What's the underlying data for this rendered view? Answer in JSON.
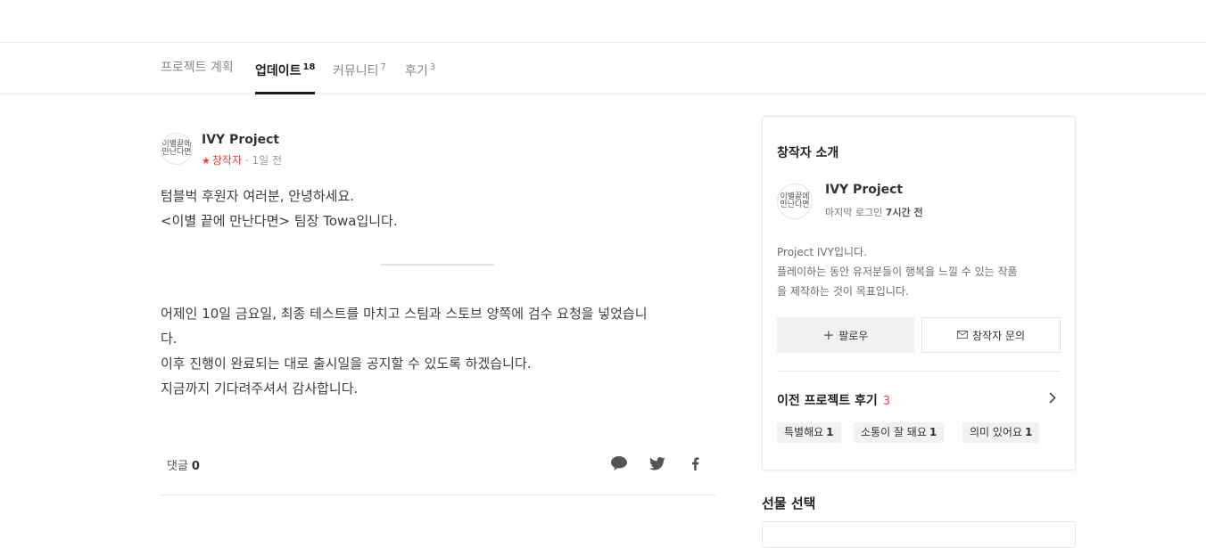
{
  "tabs": [
    {
      "label": "프로젝트 계획",
      "count": ""
    },
    {
      "label": "업데이트",
      "count": "18"
    },
    {
      "label": "커뮤니티",
      "count": "7"
    },
    {
      "label": "후기",
      "count": "3"
    }
  ],
  "post": {
    "author": "IVY Project",
    "creator_label": "창작자",
    "time_ago": "· 1일 전",
    "avatar_text": "이별끝에 만난다면",
    "lines": [
      "텀블벅 후원자 여러분, 안녕하세요.",
      "<이별 끝에 만난다면> 팀장 Towa입니다.",
      "어제인 10일 금요일, 최종 테스트를 마치고 스팀과 스토브 양쪽에 검수 요청을 넣었습니",
      "다.",
      "이후 진행이 완료되는 대로 출시일을 공지할 수 있도록 하겠습니다.",
      "지금까지 기다려주셔서 감사합니다."
    ],
    "comments_label": "댓글",
    "comments_count": "0"
  },
  "creator_card": {
    "title": "창작자 소개",
    "name": "IVY Project",
    "last_login_label": "마지막 로그인",
    "last_login_value": "7시간 전",
    "intro_lines": [
      "Project IVY입니다.",
      "플레이하는 동안 유저분들이 행복을 느낄 수 있는 작품",
      "을 제작하는 것이 목표입니다."
    ],
    "follow_label": "팔로우",
    "ask_label": "창작자 문의",
    "reviews_title": "이전 프로젝트 후기",
    "reviews_count": "3",
    "tags": [
      {
        "label": "특별해요",
        "count": "1"
      },
      {
        "label": "소통이 잘 돼요",
        "count": "1"
      },
      {
        "label": "의미 있어요",
        "count": "1"
      }
    ]
  },
  "gift_title": "선물 선택",
  "colors": {
    "accent": "#f1443c",
    "text": "#3d3d3d"
  }
}
